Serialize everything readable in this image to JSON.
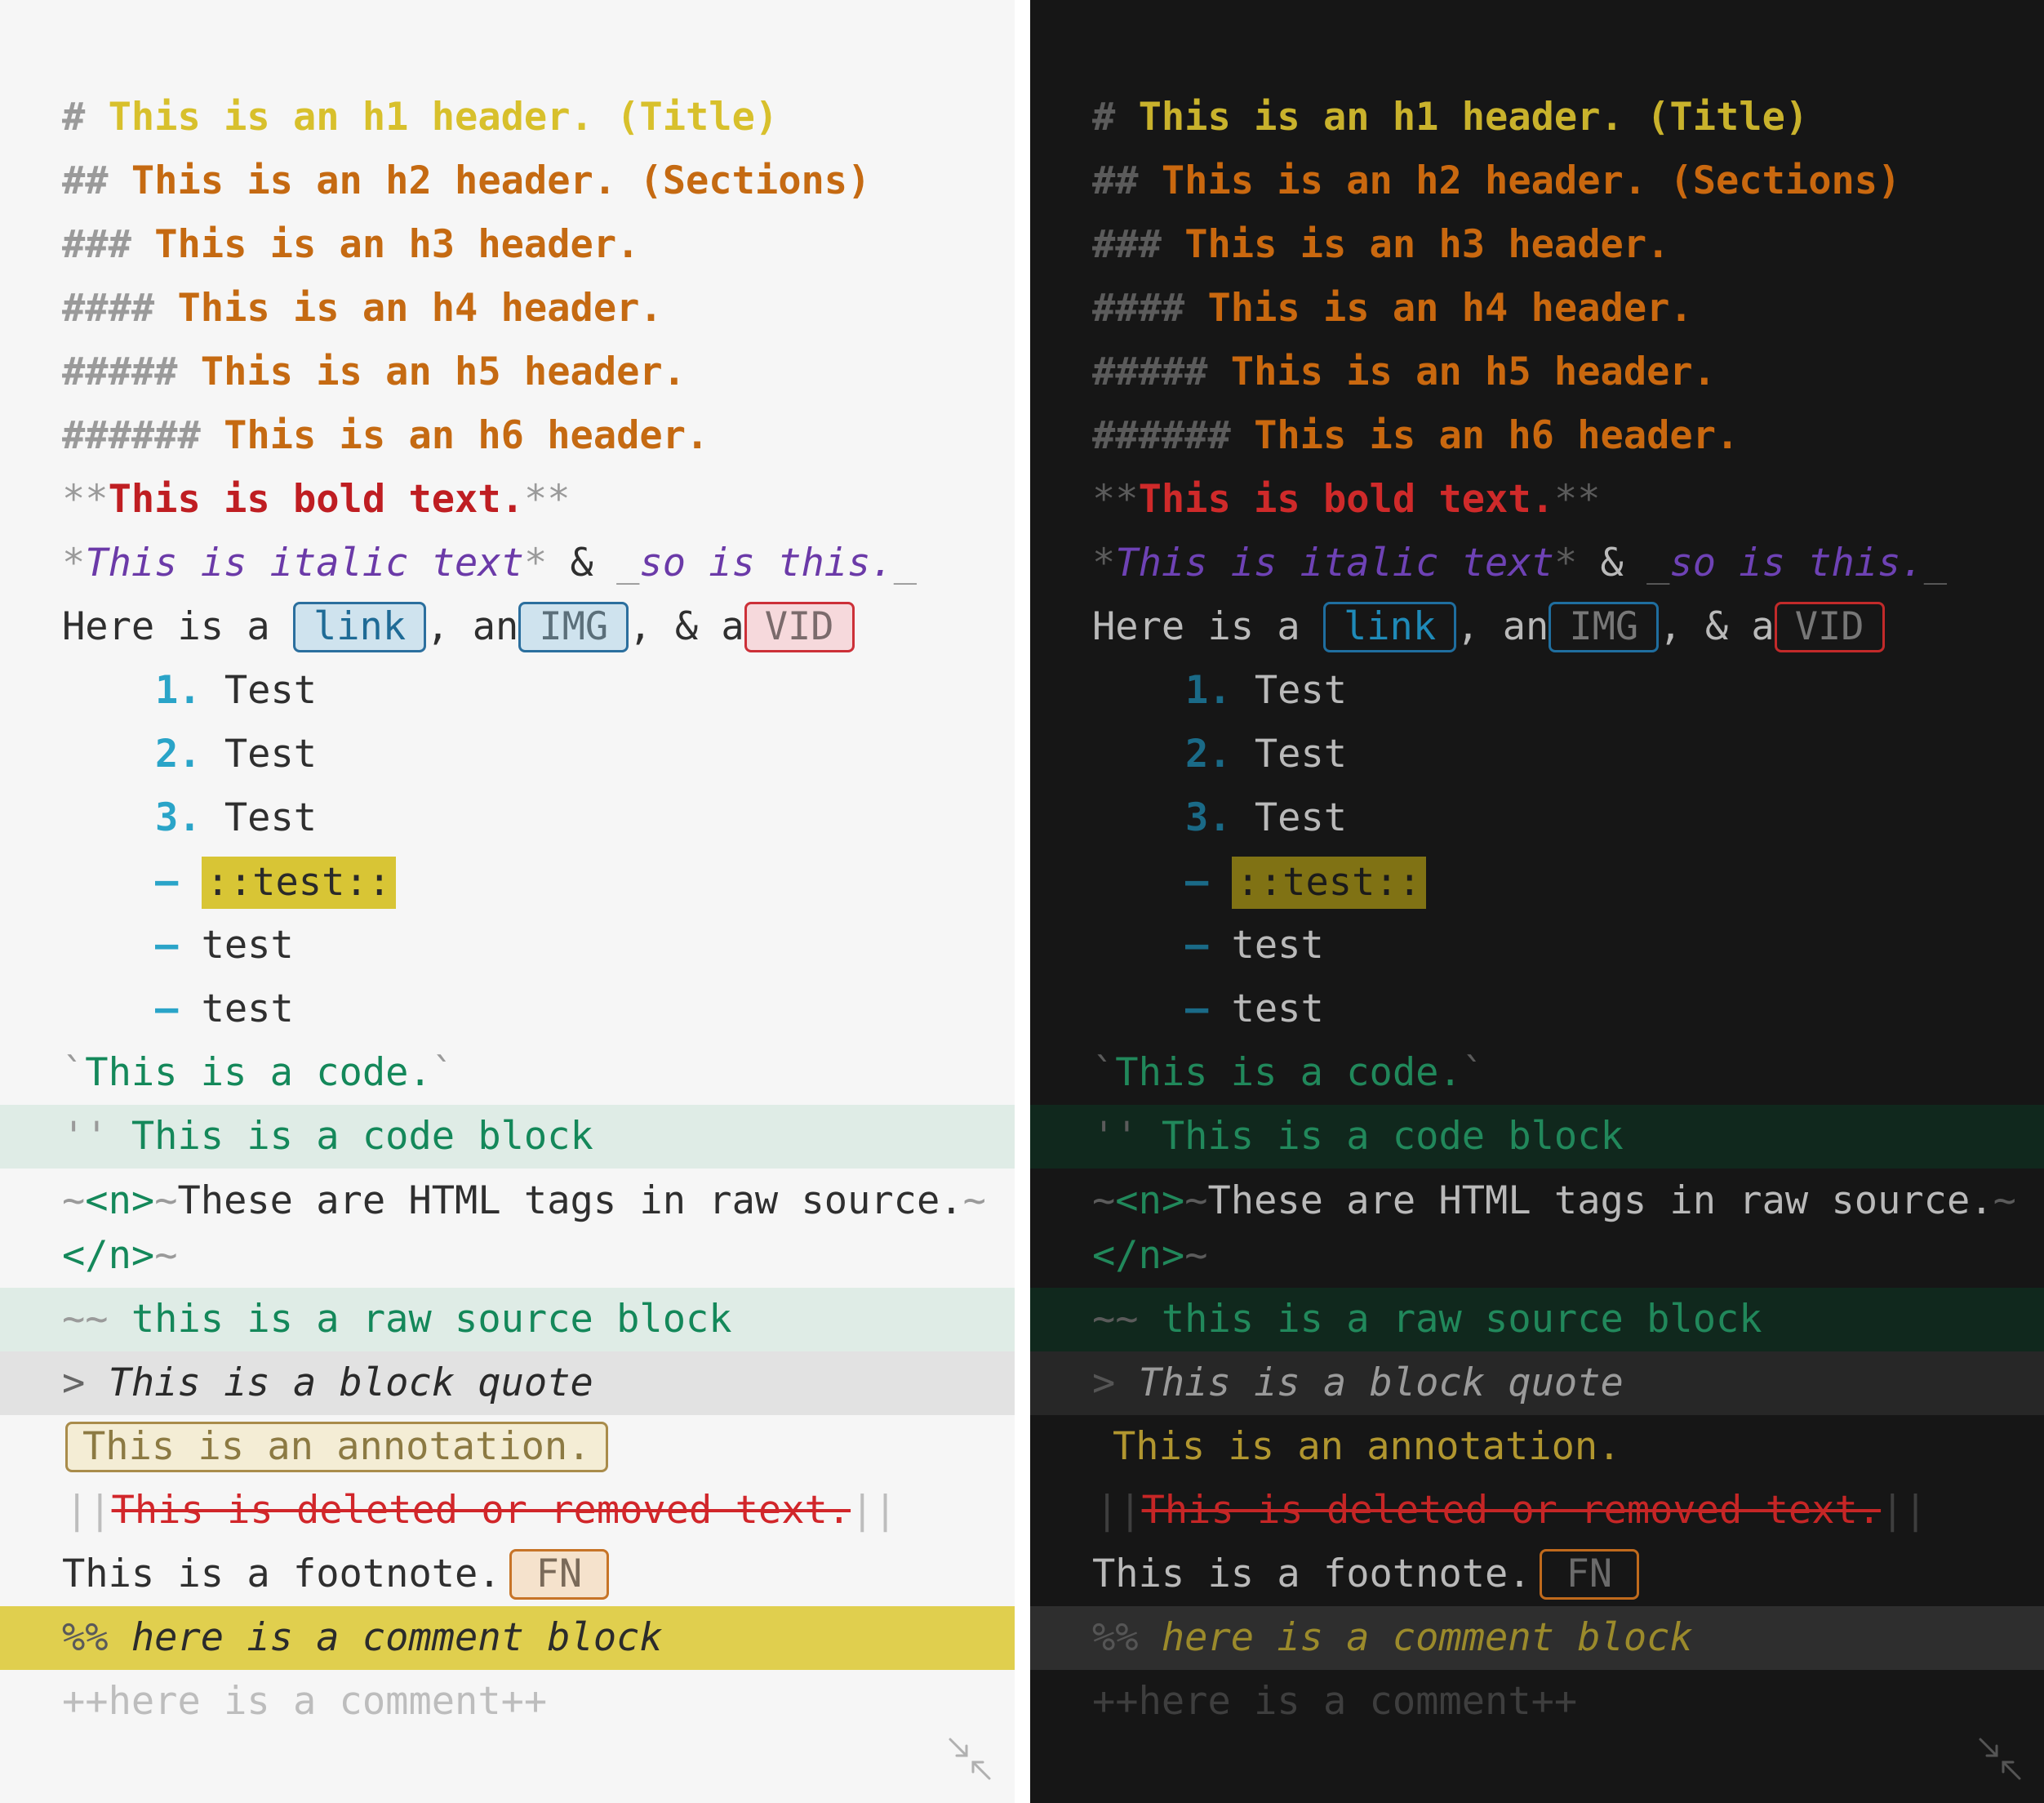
{
  "light": {
    "h1": {
      "mark": "#",
      "text": "This is an h1 header. (Title)"
    },
    "h2": {
      "mark": "##",
      "text": "This is an h2 header. (Sections)"
    },
    "h3": {
      "mark": "###",
      "text": "This is an h3 header."
    },
    "h4": {
      "mark": "####",
      "text": "This is an h4 header."
    },
    "h5": {
      "mark": "#####",
      "text": "This is an h5 header."
    },
    "h6": {
      "mark": "######",
      "text": "This is an h6 header."
    },
    "bold": {
      "open": "**",
      "text": "This is bold text.",
      "close": "**"
    },
    "italic": {
      "m1": "*",
      "t1": "This is italic text",
      "m2": "*",
      "amp": " & ",
      "m3": "_",
      "t2": "so is this.",
      "m4": "_"
    },
    "links": {
      "prefix": "Here is a ",
      "link": "link",
      "sep1": ", an",
      "img": "IMG",
      "sep2": ", & a",
      "vid": "VID"
    },
    "ordered": [
      {
        "num": "1.",
        "text": "Test"
      },
      {
        "num": "2.",
        "text": "Test"
      },
      {
        "num": "3.",
        "text": "Test"
      }
    ],
    "bullets": [
      {
        "dash": "–",
        "text": "::test::"
      },
      {
        "dash": "–",
        "text": "test"
      },
      {
        "dash": "–",
        "text": "test"
      }
    ],
    "inline_code": {
      "open": "`",
      "text": "This is a code.",
      "close": "`"
    },
    "code_block": {
      "mark": "''",
      "text": " This is a code block"
    },
    "html_tags": {
      "m1": "~",
      "open_tag": "<n>",
      "m2": "~",
      "text": "These are HTML tags in raw source.",
      "m3": "~",
      "close_tag": "</n>",
      "m4": "~"
    },
    "raw_block": {
      "mark": "~~",
      "text": " this is a raw source block"
    },
    "quote": {
      "mark": ">",
      "text": " This is a block quote"
    },
    "annotation": "This is an annotation.",
    "deleted": {
      "open": "||",
      "text": "This is deleted or removed text.",
      "close": "||"
    },
    "footnote": {
      "text": "This is a footnote.",
      "badge": "FN"
    },
    "comment_block": {
      "mark": "%%",
      "text": " here is a comment block"
    },
    "comment": "++here is a comment++"
  },
  "dark": {
    "h1": {
      "mark": "#",
      "text": "This is an h1 header. (Title)"
    },
    "h2": {
      "mark": "##",
      "text": "This is an h2 header. (Sections)"
    },
    "h3": {
      "mark": "###",
      "text": "This is an h3 header."
    },
    "h4": {
      "mark": "####",
      "text": "This is an h4 header."
    },
    "h5": {
      "mark": "#####",
      "text": "This is an h5 header."
    },
    "h6": {
      "mark": "######",
      "text": "This is an h6 header."
    },
    "bold": {
      "open": "**",
      "text": "This is bold text.",
      "close": "**"
    },
    "italic": {
      "m1": "*",
      "t1": "This is italic text",
      "m2": "*",
      "amp": " & ",
      "m3": "_",
      "t2": "so is this.",
      "m4": "_"
    },
    "links": {
      "prefix": "Here is a ",
      "link": "link",
      "sep1": ", an",
      "img": "IMG",
      "sep2": ", & a",
      "vid": "VID"
    },
    "ordered": [
      {
        "num": "1.",
        "text": "Test"
      },
      {
        "num": "2.",
        "text": "Test"
      },
      {
        "num": "3.",
        "text": "Test"
      }
    ],
    "bullets": [
      {
        "dash": "–",
        "text": "::test::"
      },
      {
        "dash": "–",
        "text": "test"
      },
      {
        "dash": "–",
        "text": "test"
      }
    ],
    "inline_code": {
      "open": "`",
      "text": "This is a code.",
      "close": "`"
    },
    "code_block": {
      "mark": "''",
      "text": " This is a code block"
    },
    "html_tags": {
      "m1": "~",
      "open_tag": "<n>",
      "m2": "~",
      "text": "These are HTML tags in raw source.",
      "m3": "~",
      "close_tag": "</n>",
      "m4": "~"
    },
    "raw_block": {
      "mark": "~~",
      "text": " this is a raw source block"
    },
    "quote": {
      "mark": ">",
      "text": " This is a block quote"
    },
    "annotation": "This is an annotation.",
    "deleted": {
      "open": "||",
      "text": "This is deleted or removed text.",
      "close": "||"
    },
    "footnote": {
      "text": "This is a footnote.",
      "badge": "FN"
    },
    "comment_block": {
      "mark": "%%",
      "text": " here is a comment block"
    },
    "comment": "++here is a comment++"
  },
  "icons": {
    "collapse": "collapse-arrows-icon"
  },
  "colors": {
    "light_bg": "#f6f6f6",
    "dark_bg": "#161616",
    "h1_light": "#d8c02c",
    "h2_light": "#c56a12",
    "bold_red": "#bf1e22",
    "italic_purple": "#6b3aa8",
    "list_blue": "#2aa4c8",
    "code_green": "#14885a",
    "comment_yellow": "#e0cf4e"
  }
}
